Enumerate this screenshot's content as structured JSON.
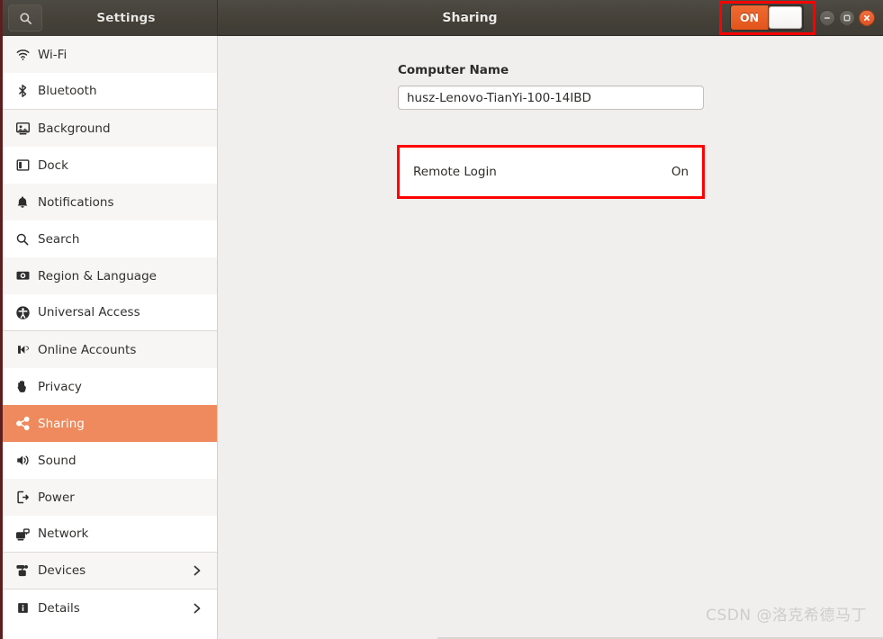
{
  "window": {
    "title": "Sharing",
    "sidebar_title": "Settings",
    "search_icon": "search-icon",
    "controls": [
      {
        "name": "minimize-button",
        "icon": "minimize-icon"
      },
      {
        "name": "maximize-button",
        "icon": "maximize-icon"
      },
      {
        "name": "close-button",
        "icon": "close-icon"
      }
    ]
  },
  "master_switch": {
    "label": "ON",
    "state": "on",
    "accent": "#e2551b",
    "annotated": true,
    "annotation_color": "#ff0000"
  },
  "sidebar": {
    "selected": "Sharing",
    "selected_color": "#ee8a5d",
    "items": [
      {
        "label": "Wi-Fi",
        "icon": "wifi-icon",
        "group_end": false,
        "chevron": false
      },
      {
        "label": "Bluetooth",
        "icon": "bluetooth-icon",
        "group_end": true,
        "chevron": false
      },
      {
        "label": "Background",
        "icon": "background-icon",
        "group_end": false,
        "chevron": false
      },
      {
        "label": "Dock",
        "icon": "dock-icon",
        "group_end": false,
        "chevron": false
      },
      {
        "label": "Notifications",
        "icon": "bell-icon",
        "group_end": false,
        "chevron": false
      },
      {
        "label": "Search",
        "icon": "search-icon",
        "group_end": false,
        "chevron": false
      },
      {
        "label": "Region & Language",
        "icon": "region-language-icon",
        "group_end": false,
        "chevron": false
      },
      {
        "label": "Universal Access",
        "icon": "universal-access-icon",
        "group_end": true,
        "chevron": false
      },
      {
        "label": "Online Accounts",
        "icon": "online-accounts-icon",
        "group_end": false,
        "chevron": false
      },
      {
        "label": "Privacy",
        "icon": "privacy-hand-icon",
        "group_end": false,
        "chevron": false
      },
      {
        "label": "Sharing",
        "icon": "sharing-icon",
        "group_end": false,
        "chevron": false
      },
      {
        "label": "Sound",
        "icon": "sound-icon",
        "group_end": false,
        "chevron": false
      },
      {
        "label": "Power",
        "icon": "power-icon",
        "group_end": false,
        "chevron": false
      },
      {
        "label": "Network",
        "icon": "network-icon",
        "group_end": true,
        "chevron": false
      },
      {
        "label": "Devices",
        "icon": "devices-icon",
        "group_end": true,
        "chevron": true
      },
      {
        "label": "Details",
        "icon": "details-info-icon",
        "group_end": false,
        "chevron": true
      }
    ]
  },
  "main": {
    "computer_name": {
      "label": "Computer Name",
      "value": "husz-Lenovo-TianYi-100-14IBD",
      "placeholder": "Computer Name"
    },
    "remote_login": {
      "label": "Remote Login",
      "value": "On",
      "annotated": true,
      "annotation_color": "#ff0000"
    }
  },
  "watermark": {
    "text": "CSDN @洛克希德马丁"
  }
}
